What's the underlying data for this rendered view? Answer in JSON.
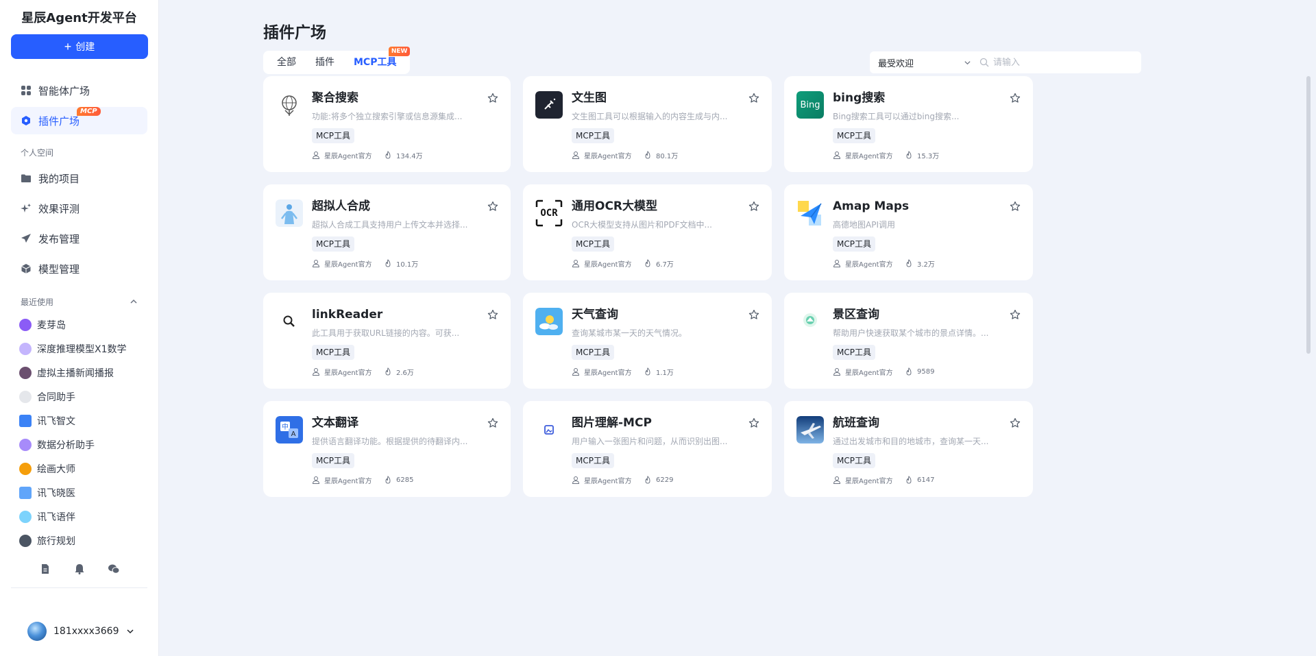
{
  "brand": "星辰Agent开发平台",
  "create_button": "创建",
  "nav": [
    {
      "label": "智能体广场",
      "icon": "grid-icon",
      "active": false
    },
    {
      "label": "插件广场",
      "icon": "plugin-icon",
      "active": true,
      "badge": "MCP"
    }
  ],
  "personal_space_label": "个人空间",
  "personal_nav": [
    {
      "label": "我的项目",
      "icon": "folder-icon"
    },
    {
      "label": "效果评测",
      "icon": "sparkle-icon"
    },
    {
      "label": "发布管理",
      "icon": "send-icon"
    },
    {
      "label": "模型管理",
      "icon": "cube-icon"
    }
  ],
  "recent_label": "最近使用",
  "recent": [
    {
      "label": "麦芽岛",
      "color": "#8b5cf6"
    },
    {
      "label": "深度推理模型X1数学",
      "color": "#c4b5fd"
    },
    {
      "label": "虚拟主播新闻播报",
      "color": "#6b4f6f"
    },
    {
      "label": "合同助手",
      "color": "#e5e7eb"
    },
    {
      "label": "讯飞智文",
      "color": "#3b82f6"
    },
    {
      "label": "数据分析助手",
      "color": "#a78bfa"
    },
    {
      "label": "绘画大师",
      "color": "#f59e0b"
    },
    {
      "label": "讯飞晓医",
      "color": "#60a5fa"
    },
    {
      "label": "讯飞语伴",
      "color": "#7dd3fc"
    },
    {
      "label": "旅行规划",
      "color": "#4b5563"
    }
  ],
  "user": {
    "name": "181xxxx3669"
  },
  "main": {
    "title": "插件广场",
    "tabs": [
      {
        "label": "全部",
        "active": false
      },
      {
        "label": "插件",
        "active": false
      },
      {
        "label": "MCP工具",
        "active": true,
        "badge": "NEW"
      }
    ],
    "sort": "最受欢迎",
    "search_placeholder": "请输入"
  },
  "colors": {
    "accent": "#275eff",
    "badge": "#ff6a33"
  },
  "cards": [
    {
      "name": "聚合搜索",
      "desc": "功能:将多个独立搜索引擎或信息源集成...",
      "tag": "MCP工具",
      "author": "星辰Agent官方",
      "heat": "134.4万",
      "logo": "search-globe-icon"
    },
    {
      "name": "文生图",
      "desc": "文生图工具可以根据输入的内容生成与内...",
      "tag": "MCP工具",
      "author": "星辰Agent官方",
      "heat": "80.1万",
      "logo": "image-gen-icon"
    },
    {
      "name": "bing搜索",
      "desc": "Bing搜索工具可以通过bing搜索...",
      "tag": "MCP工具",
      "author": "星辰Agent官方",
      "heat": "15.3万",
      "logo": "bing-icon",
      "logo_text": "Bing"
    },
    {
      "name": "超拟人合成",
      "desc": "超拟人合成工具支持用户上传文本并选择...",
      "tag": "MCP工具",
      "author": "星辰Agent官方",
      "heat": "10.1万",
      "logo": "human-figure-icon"
    },
    {
      "name": "通用OCR大模型",
      "desc": "OCR大模型支持从图片和PDF文档中...",
      "tag": "MCP工具",
      "author": "星辰Agent官方",
      "heat": "6.7万",
      "logo": "ocr-icon",
      "logo_text": "OCR"
    },
    {
      "name": "Amap Maps",
      "desc": "高德地图API调用",
      "tag": "MCP工具",
      "author": "星辰Agent官方",
      "heat": "3.2万",
      "logo": "amap-icon"
    },
    {
      "name": "linkReader",
      "desc": "此工具用于获取URL链接的内容。可获...",
      "tag": "MCP工具",
      "author": "星辰Agent官方",
      "heat": "2.6万",
      "logo": "magnifier-icon"
    },
    {
      "name": "天气查询",
      "desc": "查询某城市某一天的天气情况。",
      "tag": "MCP工具",
      "author": "星辰Agent官方",
      "heat": "1.1万",
      "logo": "weather-icon"
    },
    {
      "name": "景区查询",
      "desc": "帮助用户快速获取某个城市的景点详情。...",
      "tag": "MCP工具",
      "author": "星辰Agent官方",
      "heat": "9589",
      "logo": "scenic-icon"
    },
    {
      "name": "文本翻译",
      "desc": "提供语言翻译功能。根据提供的待翻译内...",
      "tag": "MCP工具",
      "author": "星辰Agent官方",
      "heat": "6285",
      "logo": "translate-icon",
      "logo_text": "中"
    },
    {
      "name": "图片理解-MCP",
      "desc": "用户输入一张图片和问题，从而识别出图...",
      "tag": "MCP工具",
      "author": "星辰Agent官方",
      "heat": "6229",
      "logo": "image-understand-icon"
    },
    {
      "name": "航班查询",
      "desc": "通过出发城市和目的地城市，查询某一天...",
      "tag": "MCP工具",
      "author": "星辰Agent官方",
      "heat": "6147",
      "logo": "airplane-icon"
    }
  ]
}
